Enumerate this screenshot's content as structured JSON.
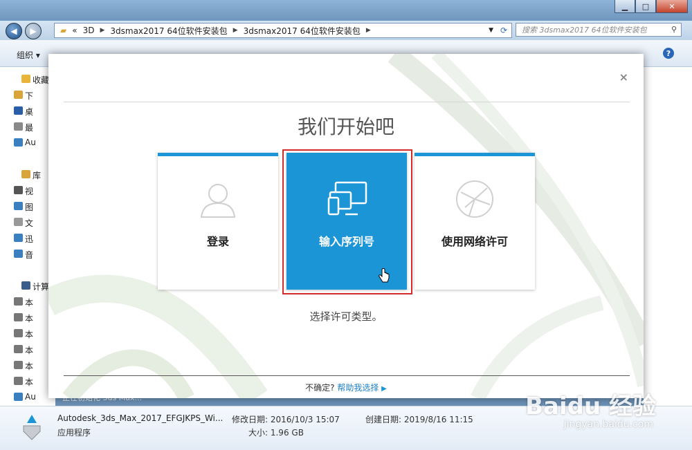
{
  "window": {
    "min_icon": "minimize-icon",
    "max_icon": "maximize-icon",
    "close_icon": "close-icon"
  },
  "navbar": {
    "breadcrumb_prefix": "«",
    "crumbs": [
      "3D",
      "3dsmax2017 64位软件安装包",
      "3dsmax2017 64位软件安装包"
    ],
    "search_placeholder": "搜索 3dsmax2017 64位软件安装包"
  },
  "toolbar": {
    "organize_label": "组织 ▾",
    "help_label": "?"
  },
  "sidebar": {
    "items": [
      {
        "label": "收藏",
        "icon": "star-icon",
        "color": "#e8b53a"
      },
      {
        "label": "下",
        "icon": "download-folder-icon",
        "color": "#d9a43a"
      },
      {
        "label": "桌",
        "icon": "desktop-icon",
        "color": "#2b5ea8"
      },
      {
        "label": "最",
        "icon": "recent-places-icon",
        "color": "#8a8a8a"
      },
      {
        "label": "Au",
        "icon": "network-icon",
        "color": "#3a7fc0"
      },
      {
        "label": "库",
        "icon": "library-icon",
        "color": "#d9a43a"
      },
      {
        "label": "视",
        "icon": "video-icon",
        "color": "#555"
      },
      {
        "label": "图",
        "icon": "picture-icon",
        "color": "#3a7fc0"
      },
      {
        "label": "文",
        "icon": "document-icon",
        "color": "#999"
      },
      {
        "label": "迅",
        "icon": "xunlei-icon",
        "color": "#3a7fc0"
      },
      {
        "label": "音",
        "icon": "music-icon",
        "color": "#3a7fc0"
      },
      {
        "label": "计算",
        "icon": "computer-icon",
        "color": "#3b5f8a"
      },
      {
        "label": "本",
        "icon": "drive-icon",
        "color": "#777"
      },
      {
        "label": "本",
        "icon": "drive-icon",
        "color": "#777"
      },
      {
        "label": "本",
        "icon": "drive-icon",
        "color": "#777"
      },
      {
        "label": "本",
        "icon": "drive-icon",
        "color": "#777"
      },
      {
        "label": "本",
        "icon": "drive-icon",
        "color": "#777"
      },
      {
        "label": "本",
        "icon": "drive-icon",
        "color": "#777"
      },
      {
        "label": "Au",
        "icon": "network-icon",
        "color": "#3a7fc0"
      }
    ]
  },
  "dialog": {
    "close_label": "×",
    "title": "我们开始吧",
    "cards": [
      {
        "label": "登录",
        "icon": "user-icon"
      },
      {
        "label": "输入序列号",
        "icon": "devices-icon"
      },
      {
        "label": "使用网络许可",
        "icon": "network-globe-icon"
      }
    ],
    "prompt": "选择许可类型。",
    "footer_question": "不确定?",
    "footer_link": "帮助我选择",
    "footer_arrow": "▶"
  },
  "installing_text": "正在初始化 3ds Max...",
  "status": {
    "file_name": "Autodesk_3ds_Max_2017_EFGJKPS_Wi...",
    "file_type": "应用程序",
    "modified": "修改日期: 2016/10/3 15:07",
    "created": "创建日期: 2019/8/16 11:15",
    "size": "大小: 1.96 GB"
  },
  "watermark": {
    "brand": "Baidu 经验",
    "url": "jingyan.baidu.com"
  },
  "colors": {
    "accent": "#1b95d6",
    "highlight": "#d42a2a"
  }
}
